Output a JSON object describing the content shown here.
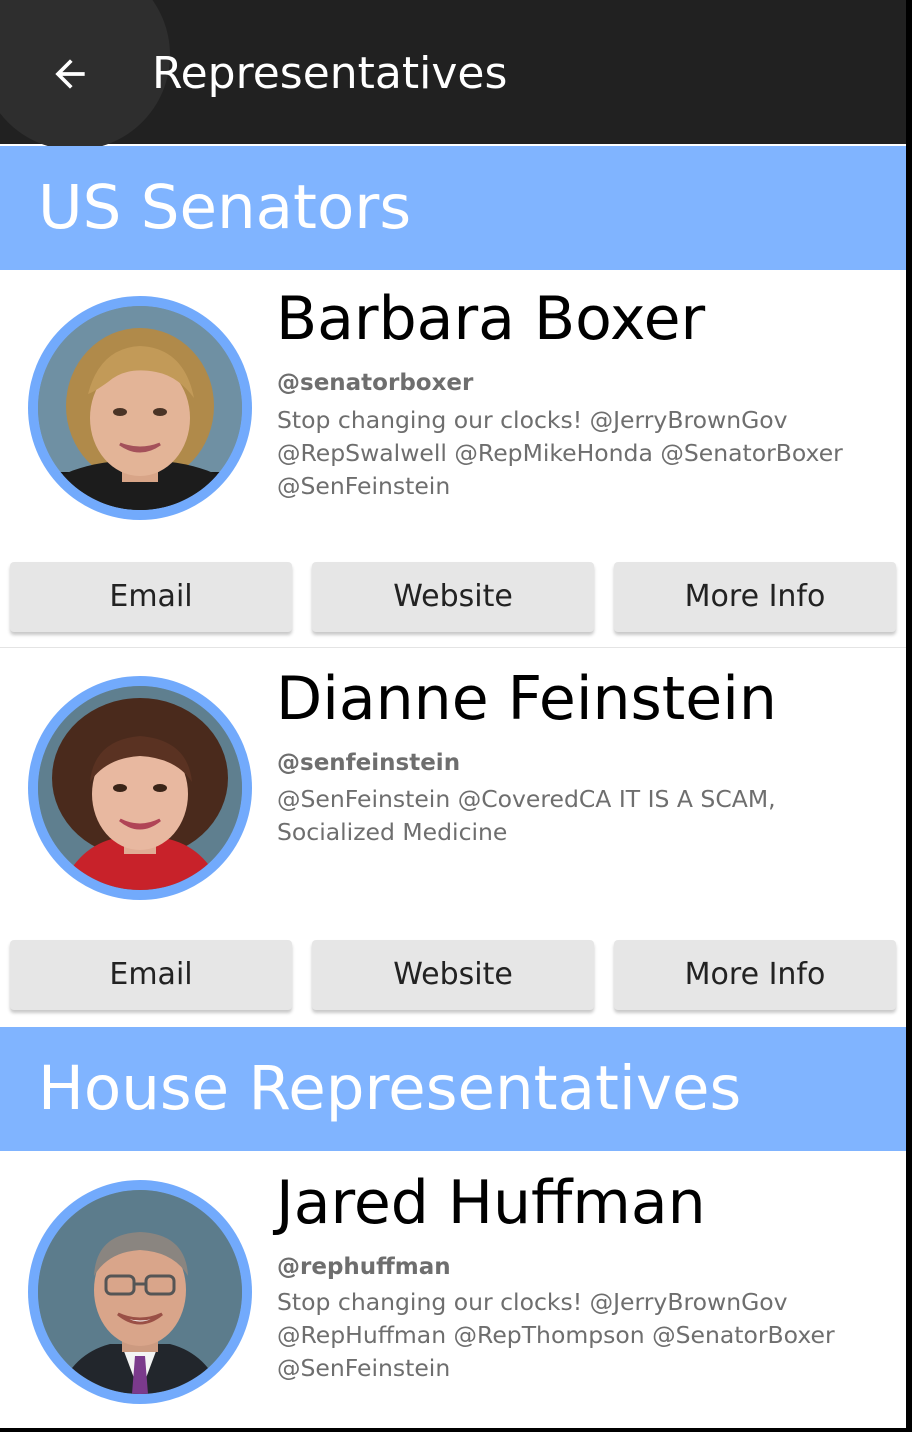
{
  "app_bar": {
    "title": "Representatives",
    "back_icon": "arrow-back-icon",
    "background": "#212121"
  },
  "sections": [
    {
      "title": "US Senators",
      "color": "#80b4ff",
      "reps": [
        {
          "name": "Barbara Boxer",
          "handle": "@senatorboxer",
          "tweet": "Stop changing our clocks! @JerryBrownGov @RepSwalwell @RepMikeHonda @SenatorBoxer @SenFeinstein",
          "buttons": {
            "email": "Email",
            "website": "Website",
            "more_info": "More Info"
          }
        },
        {
          "name": "Dianne Feinstein",
          "handle": "@senfeinstein",
          "tweet": "@SenFeinstein @CoveredCA IT IS A SCAM, Socialized Medicine",
          "buttons": {
            "email": "Email",
            "website": "Website",
            "more_info": "More Info"
          }
        }
      ]
    },
    {
      "title": "House Representatives",
      "color": "#80b4ff",
      "reps": [
        {
          "name": "Jared Huffman",
          "handle": "@rephuffman",
          "tweet": "Stop changing our clocks! @JerryBrownGov @RepHuffman @RepThompson @SenatorBoxer @SenFeinstein"
        }
      ]
    }
  ]
}
